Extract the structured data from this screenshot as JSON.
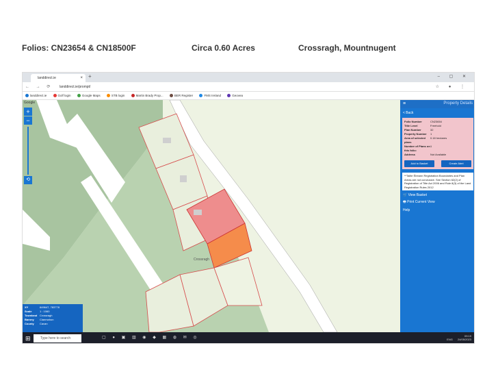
{
  "page": {
    "folios": "Folios: CN23654 & CN18500F",
    "area": "Circa 0.60 Acres",
    "location": "Crossragh, Mountnugent"
  },
  "browser": {
    "tab_title": "landdirect.ie",
    "url": "landdirect.ie/prompt/",
    "bookmarks": [
      "landdirect.ie",
      "Golf login",
      "Google Maps",
      "STB login",
      "Martin Brady Prop...",
      "BER Register",
      "FMS Ireland",
      "Geovea"
    ]
  },
  "map": {
    "provider": "Google",
    "zoom_in": "+",
    "zoom_out": "−",
    "road_label": "Crossragh",
    "info": [
      {
        "k": "XY",
        "v": "649647, 783778"
      },
      {
        "k": "Scale",
        "v": "1 : 1060"
      },
      {
        "k": "Townland",
        "v": "Crossragh"
      },
      {
        "k": "Barony",
        "v": "Clanmahon"
      },
      {
        "k": "County",
        "v": "Cavan"
      }
    ]
  },
  "panel": {
    "title": "Property Details",
    "back": "< Back",
    "details": [
      {
        "k": "Folio Number",
        "v": "CN23654"
      },
      {
        "k": "Title Level",
        "v": "Freehold"
      },
      {
        "k": "Plan Number",
        "v": "32"
      },
      {
        "k": "Property Number",
        "v": "1"
      },
      {
        "k": "Area of selected plans",
        "v": "0.18 hectares"
      },
      {
        "k": "Number of Plans on this folio:",
        "v": "1"
      },
      {
        "k": "Address",
        "v": "Not Available"
      }
    ],
    "add_basket": "Add to Basket",
    "create_alert": "Create Alert",
    "note_text": "**Tailte Éireann Registration Boundaries and Plan Areas are not conclusive. See Section 62(2) of Registration of Title Act 2006 and Rule 8(3) of the Land Registration Rules 2012",
    "view_basket": "View Basket",
    "print_view": "Print Current View",
    "help": "Help"
  },
  "taskbar": {
    "search": "Type here to search",
    "time": "09:19",
    "date": "24/05/2023",
    "lang": "ENG"
  }
}
